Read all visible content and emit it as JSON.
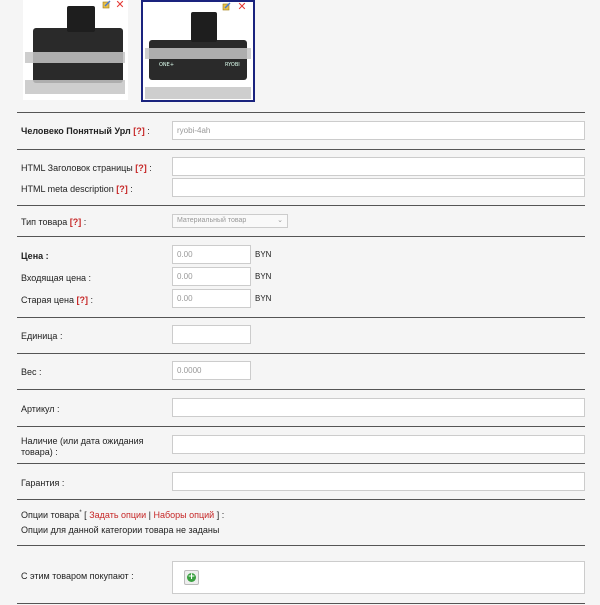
{
  "images": [
    {
      "alt": "battery-image-1"
    },
    {
      "alt": "battery-image-2",
      "brand_text": "RYOBI",
      "series_text": "ONE+"
    }
  ],
  "seo_url": {
    "label": "Человеко Понятный Урл",
    "help": "[?]",
    "suffix": " :",
    "value": "ryobi-4ah"
  },
  "html_title": {
    "label": "HTML Заголовок страницы",
    "help": "[?]",
    "suffix": " :",
    "value": ""
  },
  "meta_description": {
    "label": "HTML meta description",
    "help": "[?]",
    "suffix": " :",
    "value": ""
  },
  "product_type": {
    "label": "Тип товара",
    "help": "[?]",
    "suffix": " :",
    "value": "Материальный товар"
  },
  "price": {
    "label": "Цена :",
    "value": "0.00",
    "currency": "BYN"
  },
  "purchase_price": {
    "label": "Входящая цена :",
    "value": "0.00",
    "currency": "BYN"
  },
  "old_price": {
    "label": "Старая цена",
    "help": "[?]",
    "suffix": " :",
    "value": "0.00",
    "currency": "BYN"
  },
  "unit": {
    "label": "Единица :",
    "value": ""
  },
  "weight": {
    "label": "Вес :",
    "value": "0.0000"
  },
  "sku": {
    "label": "Артикул :",
    "value": ""
  },
  "availability": {
    "label_line1": "Наличие (или дата ожидания",
    "label_line2": "товара) :",
    "value": ""
  },
  "warranty": {
    "label": "Гарантия :",
    "value": ""
  },
  "options": {
    "label": "Опции товара",
    "bullet": "*",
    "open_bracket": "[",
    "set_options": "Задать опции",
    "separator": "|",
    "option_sets": "Наборы опций",
    "close": "] :",
    "message": "Опции для данной категории товара не заданы"
  },
  "related": {
    "label": "С этим товаром покупают :",
    "add_icon": "plus-circle-icon"
  },
  "colors": {
    "help": "#c62828",
    "selected_border": "#1a237e",
    "add_green": "#3aa040"
  }
}
